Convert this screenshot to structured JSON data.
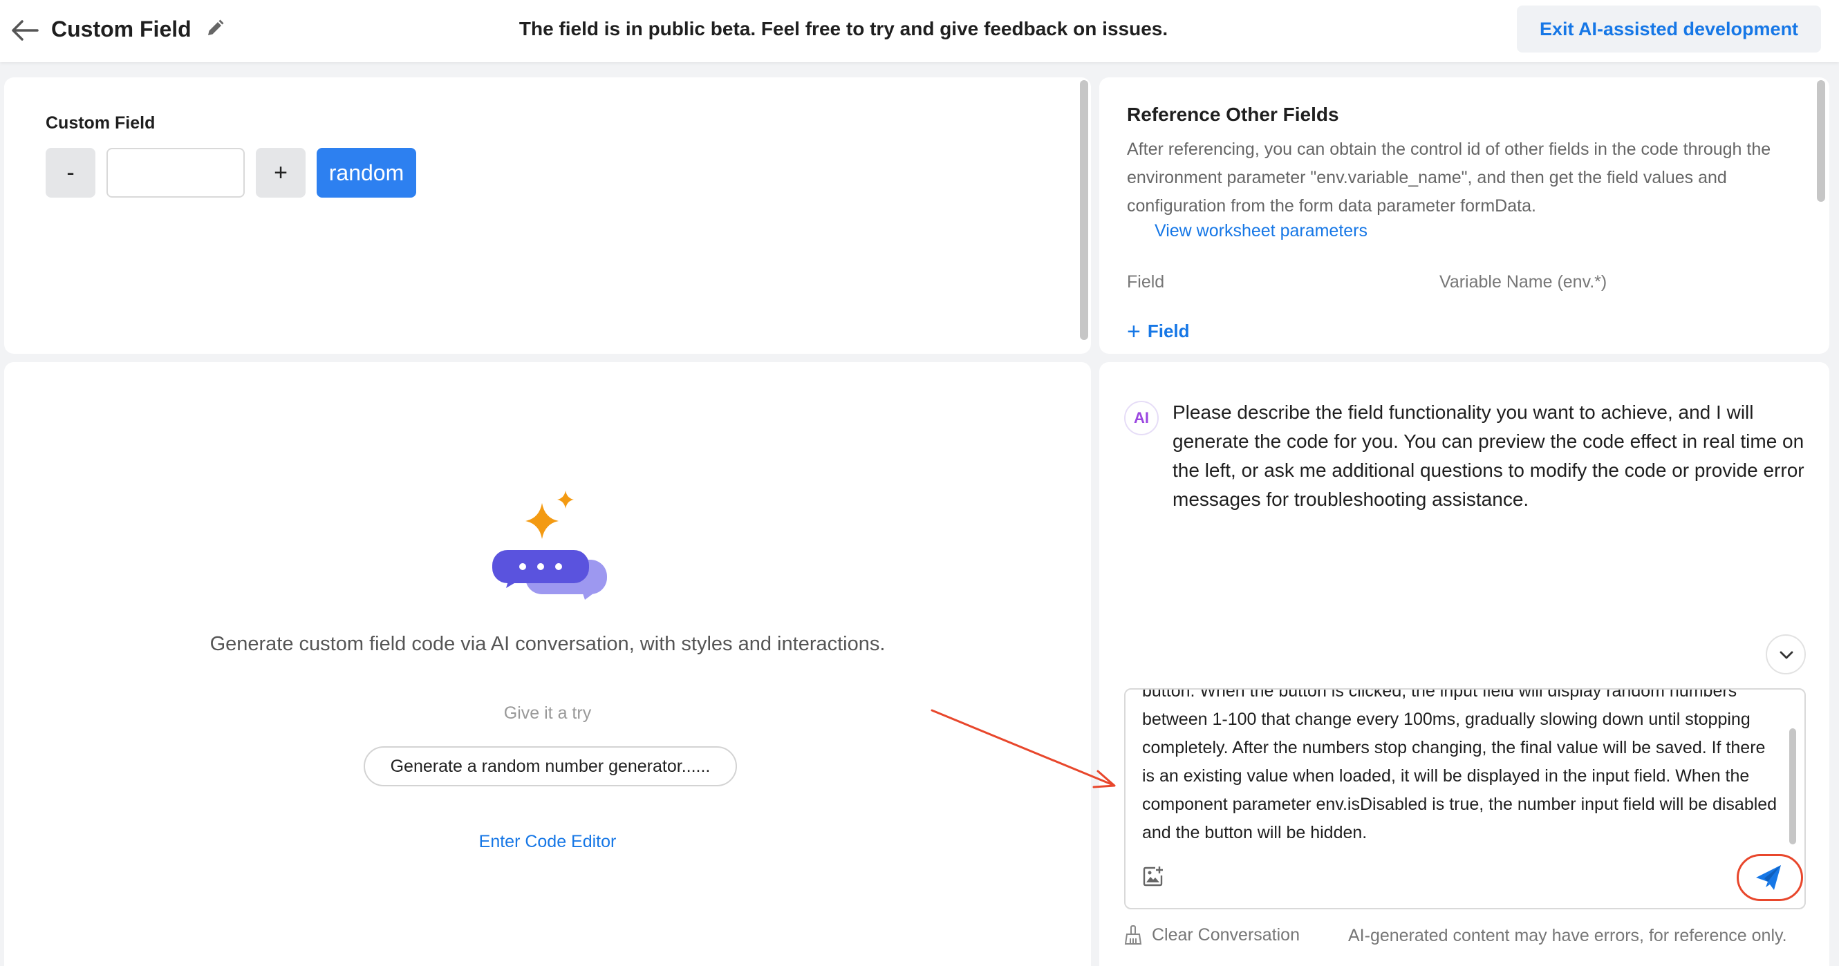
{
  "header": {
    "title": "Custom Field",
    "beta_message": "The field is in public beta. Feel free to try and give feedback on issues.",
    "exit_button": "Exit AI-assisted development"
  },
  "preview": {
    "field_label": "Custom Field",
    "minus_label": "-",
    "plus_label": "+",
    "random_label": "random",
    "input_value": ""
  },
  "reference": {
    "title": "Reference Other Fields",
    "description": "After referencing, you can obtain the control id of other fields in the code through the environment parameter \"env.variable_name\", and then get the field values and configuration from the form data parameter formData.",
    "link": "View worksheet parameters",
    "col_field": "Field",
    "col_variable": "Variable Name (env.*)",
    "add_field": "Field"
  },
  "generator": {
    "description": "Generate custom field code via AI conversation, with styles and interactions.",
    "try_label": "Give it a try",
    "example_prompt": "Generate a random number generator......",
    "code_editor_link": "Enter Code Editor"
  },
  "chat": {
    "ai_badge": "AI",
    "ai_message": "Please describe the field functionality you want to achieve, and I will generate the code for you. You can preview the code effect in real time on the left, or ask me additional questions to modify the code or provide error messages for troubleshooting assistance.",
    "input_text": "button. When the button is clicked, the input field will display random numbers between 1-100 that change every 100ms, gradually slowing down until stopping completely. After the numbers stop changing, the final value will be saved. If there is an existing value when loaded, it will be displayed in the input field. When the component parameter env.isDisabled is true, the number input field will be disabled and the button will be hidden.",
    "clear_label": "Clear Conversation",
    "disclaimer": "AI-generated content may have errors, for reference only."
  },
  "colors": {
    "accent": "#1677e6",
    "primary_button": "#2d80f0",
    "annotation": "#e8472c",
    "sparkle": "#f39a12",
    "bubble_front": "#5a53de",
    "bubble_back": "#9d98f0"
  }
}
